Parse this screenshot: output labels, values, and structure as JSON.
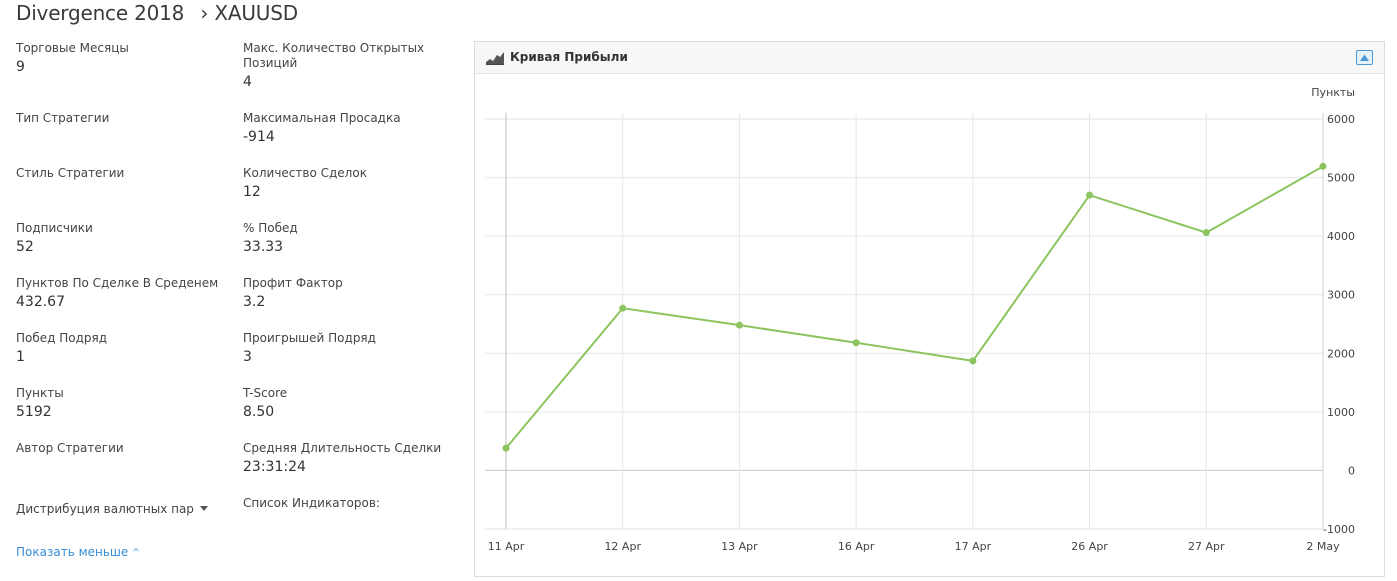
{
  "header": {
    "strategy_name": "Divergence 2018",
    "separator": "›",
    "symbol": "XAUUSD"
  },
  "stats_left": [
    {
      "label": "Торговые Месяцы",
      "value": "9"
    },
    {
      "label": "Тип Стратегии",
      "value": ""
    },
    {
      "label": "Стиль Стратегии",
      "value": ""
    },
    {
      "label": "Подписчики",
      "value": "52"
    },
    {
      "label": "Пунктов По Сделке В Среденем",
      "value": "432.67"
    },
    {
      "label": "Побед Подряд",
      "value": "1"
    },
    {
      "label": "Пункты",
      "value": "5192"
    },
    {
      "label": "Автор Стратегии",
      "value": ""
    }
  ],
  "stats_right": [
    {
      "label": "Макс. Количество Открытых Позиций",
      "value": "4"
    },
    {
      "label": "Максимальная Просадка",
      "value": "-914"
    },
    {
      "label": "Количество Сделок",
      "value": "12"
    },
    {
      "label": "% Побед",
      "value": "33.33"
    },
    {
      "label": "Профит Фактор",
      "value": "3.2"
    },
    {
      "label": "Проигрышей Подряд",
      "value": "3"
    },
    {
      "label": "T-Score",
      "value": "8.50"
    },
    {
      "label": "Средняя Длительность Сделки",
      "value": "23:31:24"
    }
  ],
  "currency_distribution_label": "Дистрибуция валютных пар",
  "indicators_label": "Список Индикаторов:",
  "show_less_label": "Показать меньше",
  "panel": {
    "title": "Кривая Прибыли",
    "icons": [
      "area-chart-icon",
      "collapse-toggle-icon"
    ]
  },
  "colors": {
    "line": "#8cc560",
    "link": "#3a8ed6",
    "grid": "#e6e6e6"
  },
  "chart_data": {
    "type": "line",
    "categories": [
      "11 Apr",
      "12 Apr",
      "13 Apr",
      "16 Apr",
      "17 Apr",
      "26 Apr",
      "27 Apr",
      "2 May"
    ],
    "series": [
      {
        "values": [
          380,
          2770,
          2480,
          2180,
          1870,
          4700,
          4060,
          5192
        ]
      }
    ],
    "ylabel": "Пункты",
    "ylim": [
      -1000,
      6000
    ],
    "yticks": [
      -1000,
      0,
      1000,
      2000,
      3000,
      4000,
      5000,
      6000
    ],
    "y_axis_side": "right",
    "grid": true
  }
}
